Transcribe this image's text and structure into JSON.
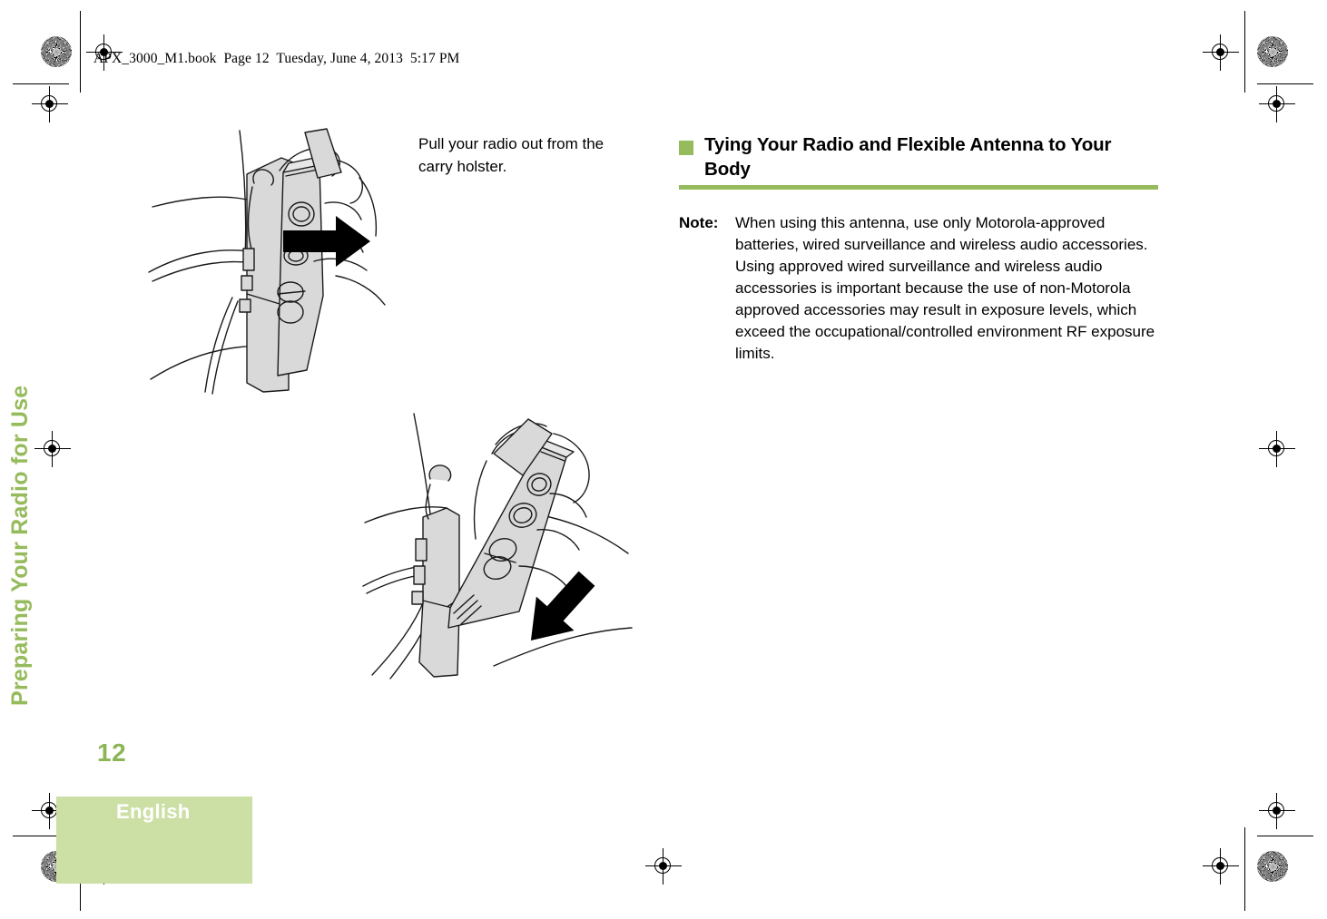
{
  "document": {
    "book_header": "APX_3000_M1.book  Page 12  Tuesday, June 4, 2013  5:17 PM",
    "chapter_tab": "Preparing Your Radio for Use",
    "page_number": "12",
    "language": "English"
  },
  "colors": {
    "accent_green": "#95bb5c",
    "band_green": "#ccdfa5",
    "page_number_green": "#8cb557",
    "illustration_fill": "#d9d9d9",
    "illustration_stroke": "#1a1a1a"
  },
  "left_column": {
    "caption": "Pull your radio out from the carry holster.",
    "figures": [
      {
        "name": "radio-pulled-from-holster",
        "arrow_direction": "right"
      },
      {
        "name": "radio-lifted-away-from-holster",
        "arrow_direction": "up-left"
      }
    ]
  },
  "right_column": {
    "heading": "Tying Your Radio and Flexible Antenna to Your Body",
    "note": {
      "label": "Note:",
      "text": "When using this antenna, use only Motorola-approved batteries, wired surveillance and wireless audio accessories. Using approved wired surveillance and wireless audio accessories is important because the use of non-Motorola approved accessories may result in exposure levels, which exceed the occupational/controlled environment RF exposure limits."
    }
  }
}
